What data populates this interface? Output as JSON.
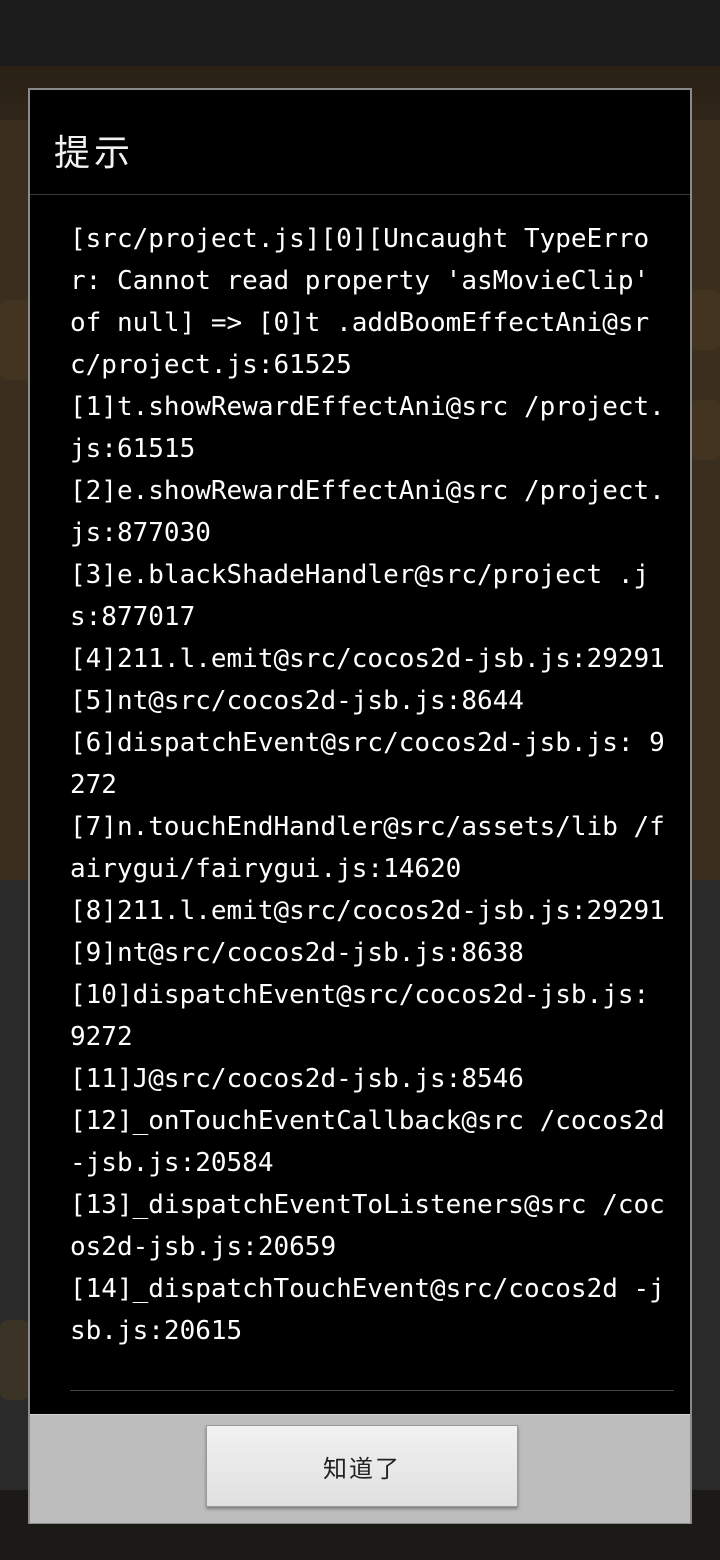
{
  "dialog": {
    "title": "提示",
    "error_lines": [
      "[src/project.js][0][Uncaught TypeError: Cannot read property 'asMovieClip' of null] => [0]t .addBoomEffectAni@src/project.js:61525",
      "[1]t.showRewardEffectAni@src /project.js:61515",
      "[2]e.showRewardEffectAni@src /project.js:877030",
      "[3]e.blackShadeHandler@src/project .js:877017",
      "[4]211.l.emit@src/cocos2d-jsb.js:29291",
      "[5]nt@src/cocos2d-jsb.js:8644",
      "[6]dispatchEvent@src/cocos2d-jsb.js: 9272",
      "[7]n.touchEndHandler@src/assets/lib /fairygui/fairygui.js:14620",
      "[8]211.l.emit@src/cocos2d-jsb.js:29291",
      "[9]nt@src/cocos2d-jsb.js:8638",
      "[10]dispatchEvent@src/cocos2d-jsb.js: 9272",
      "[11]J@src/cocos2d-jsb.js:8546",
      "[12]_onTouchEventCallback@src /cocos2d-jsb.js:20584",
      "[13]_dispatchEventToListeners@src /cocos2d-jsb.js:20659",
      "[14]_dispatchTouchEvent@src/cocos2d -jsb.js:20615"
    ],
    "ok_label": "知道了"
  }
}
